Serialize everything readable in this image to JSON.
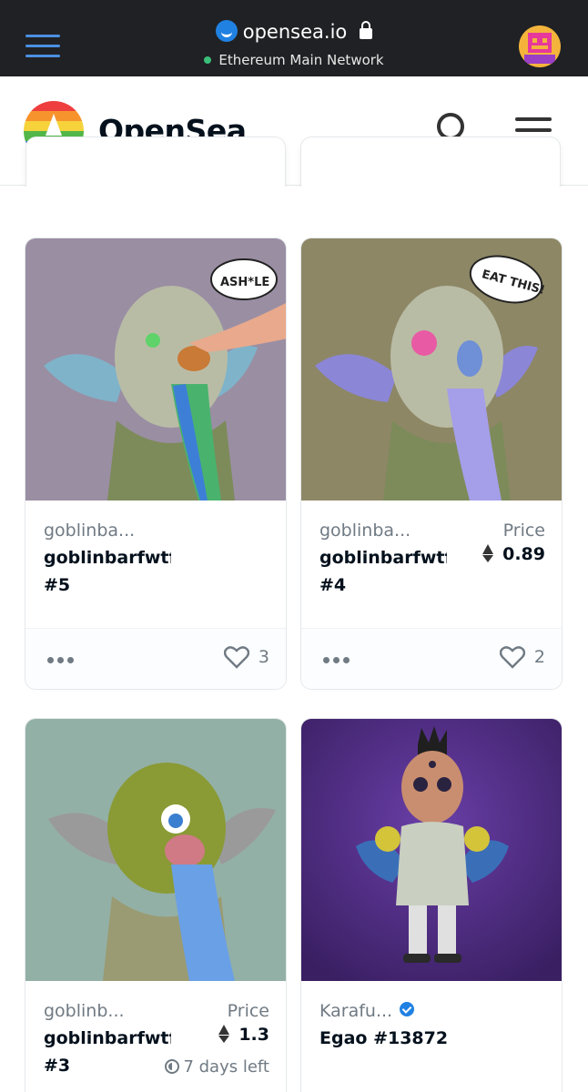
{
  "browser": {
    "url": "opensea.io",
    "network": "Ethereum Main Network"
  },
  "header": {
    "brand": "OpenSea"
  },
  "cards": [
    {
      "collection": "goblinba...",
      "name": "goblinbarfwtf",
      "number": "#5",
      "favorites": "3"
    },
    {
      "collection": "goblinba...",
      "name": "goblinbarfwtf",
      "number": "#4",
      "price_label": "Price",
      "price": "0.89",
      "favorites": "2"
    },
    {
      "collection": "goblinb...",
      "name": "goblinbarfwtf",
      "number": "#3",
      "price_label": "Price",
      "price": "1.3",
      "time_left": "7 days left"
    },
    {
      "collection": "Karafu...",
      "name": "Egao #13872"
    }
  ],
  "colors": {
    "topbar": "#202124",
    "accent": "#2081e2",
    "text_primary": "#04111d",
    "text_secondary": "#707a83"
  }
}
